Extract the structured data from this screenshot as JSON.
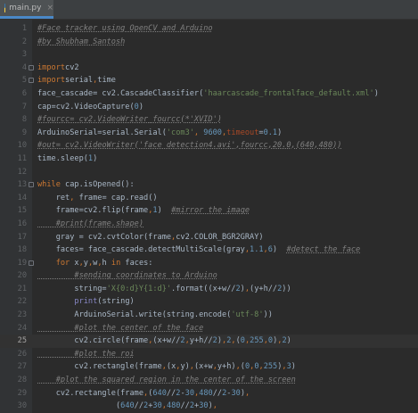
{
  "tab": {
    "label": "main.py",
    "close": "×",
    "icon": "python-file-icon"
  },
  "current_line": 25,
  "lines": [
    {
      "n": "1",
      "tokens": [
        [
          "cm",
          "#Face tracker using OpenCV and Arduino"
        ]
      ]
    },
    {
      "n": "2",
      "tokens": [
        [
          "cm",
          "#by Shubham Santosh"
        ]
      ]
    },
    {
      "n": "3",
      "tokens": []
    },
    {
      "n": "4",
      "tokens": [
        [
          "kw",
          "import"
        ],
        [
          "",
          "cv2"
        ]
      ]
    },
    {
      "n": "5",
      "tokens": [
        [
          "kw",
          "import"
        ],
        [
          "",
          "serial"
        ],
        [
          "op",
          ","
        ],
        [
          "",
          "time"
        ]
      ]
    },
    {
      "n": "6",
      "tokens": [
        [
          "",
          "face_cascade= cv2.CascadeClassifier("
        ],
        [
          "str",
          "'haarcascade_frontalface_default.xml'"
        ],
        [
          "",
          ")"
        ]
      ]
    },
    {
      "n": "7",
      "tokens": [
        [
          "",
          "cap=cv2.VideoCapture("
        ],
        [
          "num",
          "0"
        ],
        [
          "",
          ")"
        ]
      ]
    },
    {
      "n": "8",
      "tokens": [
        [
          "cm",
          "#fourcc= cv2.VideoWriter_fourcc(*'XVID')"
        ]
      ]
    },
    {
      "n": "9",
      "tokens": [
        [
          "",
          "ArduinoSerial=serial.Serial("
        ],
        [
          "str",
          "'com3'"
        ],
        [
          "op",
          ","
        ],
        [
          "num",
          " 9600"
        ],
        [
          "op",
          ","
        ],
        [
          "kwarg",
          "timeout"
        ],
        [
          "",
          "="
        ],
        [
          "num",
          "0.1"
        ],
        [
          "",
          ")"
        ]
      ]
    },
    {
      "n": "10",
      "tokens": [
        [
          "cm",
          "#out= cv2.VideoWriter('face detection4.avi',fourcc,20.0,(640,480))"
        ]
      ]
    },
    {
      "n": "11",
      "tokens": [
        [
          "",
          "time.sleep("
        ],
        [
          "num",
          "1"
        ],
        [
          "",
          ")"
        ]
      ]
    },
    {
      "n": "12",
      "tokens": []
    },
    {
      "n": "13",
      "tokens": [
        [
          "kw",
          "while"
        ],
        [
          "",
          " cap.isOpened():"
        ]
      ]
    },
    {
      "n": "14",
      "tokens": [
        [
          "",
          "    ret"
        ],
        [
          "op",
          ","
        ],
        [
          "",
          " frame= cap.read()"
        ]
      ]
    },
    {
      "n": "15",
      "tokens": [
        [
          "",
          "    frame=cv2.flip(frame"
        ],
        [
          "op",
          ","
        ],
        [
          "num",
          "1"
        ],
        [
          "",
          ")  "
        ],
        [
          "cm",
          "#mirror the image"
        ]
      ]
    },
    {
      "n": "16",
      "tokens": [
        [
          "cm",
          "    #print(frame.shape)"
        ]
      ]
    },
    {
      "n": "17",
      "tokens": [
        [
          "",
          "    gray = cv2.cvtColor(frame"
        ],
        [
          "op",
          ","
        ],
        [
          "",
          "cv2.COLOR_BGR2GRAY)"
        ]
      ]
    },
    {
      "n": "18",
      "tokens": [
        [
          "",
          "    faces= face_cascade.detectMultiScale(gray"
        ],
        [
          "op",
          ","
        ],
        [
          "num",
          "1.1"
        ],
        [
          "op",
          ","
        ],
        [
          "num",
          "6"
        ],
        [
          "",
          ")  "
        ],
        [
          "cm",
          "#detect the face"
        ]
      ]
    },
    {
      "n": "19",
      "tokens": [
        [
          "",
          "    "
        ],
        [
          "kw",
          "for"
        ],
        [
          "",
          " x"
        ],
        [
          "op",
          ","
        ],
        [
          "",
          "y"
        ],
        [
          "op",
          ","
        ],
        [
          "",
          "w"
        ],
        [
          "op",
          ","
        ],
        [
          "",
          "h "
        ],
        [
          "kw",
          "in"
        ],
        [
          "",
          " faces:"
        ]
      ]
    },
    {
      "n": "20",
      "tokens": [
        [
          "cm",
          "        #sending coordinates to Arduino"
        ]
      ]
    },
    {
      "n": "21",
      "tokens": [
        [
          "",
          "        string="
        ],
        [
          "str",
          "'X{0:d}Y{1:d}'"
        ],
        [
          "",
          ".format((x+w//"
        ],
        [
          "num",
          "2"
        ],
        [
          "",
          ")"
        ],
        [
          "op",
          ","
        ],
        [
          "",
          "(y+h//"
        ],
        [
          "num",
          "2"
        ],
        [
          "",
          "))"
        ]
      ]
    },
    {
      "n": "22",
      "tokens": [
        [
          "",
          "        "
        ],
        [
          "fn",
          "print"
        ],
        [
          "",
          "(string)"
        ]
      ]
    },
    {
      "n": "23",
      "tokens": [
        [
          "",
          "        ArduinoSerial.write(string.encode("
        ],
        [
          "str",
          "'utf-8'"
        ],
        [
          "",
          "))"
        ]
      ]
    },
    {
      "n": "24",
      "tokens": [
        [
          "cm",
          "        #plot the center of the face"
        ]
      ]
    },
    {
      "n": "25",
      "tokens": [
        [
          "",
          "        cv2.circle(frame"
        ],
        [
          "op",
          ","
        ],
        [
          "",
          "(x+w//"
        ],
        [
          "num",
          "2"
        ],
        [
          "op",
          ","
        ],
        [
          "",
          "y+h//"
        ],
        [
          "num",
          "2"
        ],
        [
          "",
          ")"
        ],
        [
          "op",
          ","
        ],
        [
          "num",
          "2"
        ],
        [
          "op",
          ","
        ],
        [
          "",
          "("
        ],
        [
          "num",
          "0"
        ],
        [
          "op",
          ","
        ],
        [
          "num",
          "255"
        ],
        [
          "op",
          ","
        ],
        [
          "num",
          "0"
        ],
        [
          "",
          ")"
        ],
        [
          "op",
          ","
        ],
        [
          "num",
          "2"
        ],
        [
          "",
          ")"
        ]
      ]
    },
    {
      "n": "26",
      "tokens": [
        [
          "cm",
          "        #plot the roi"
        ]
      ]
    },
    {
      "n": "27",
      "tokens": [
        [
          "",
          "        cv2.rectangle(frame"
        ],
        [
          "op",
          ","
        ],
        [
          "",
          "(x"
        ],
        [
          "op",
          ","
        ],
        [
          "",
          "y)"
        ],
        [
          "op",
          ","
        ],
        [
          "",
          "(x+w"
        ],
        [
          "op",
          ","
        ],
        [
          "",
          "y+h)"
        ],
        [
          "op",
          ","
        ],
        [
          "",
          "("
        ],
        [
          "num",
          "0"
        ],
        [
          "op",
          ","
        ],
        [
          "num",
          "0"
        ],
        [
          "op",
          ","
        ],
        [
          "num",
          "255"
        ],
        [
          "",
          ")"
        ],
        [
          "op",
          ","
        ],
        [
          "num",
          "3"
        ],
        [
          "",
          ")"
        ]
      ]
    },
    {
      "n": "28",
      "tokens": [
        [
          "cm",
          "    #plot the squared region in the center of the screen"
        ]
      ]
    },
    {
      "n": "29",
      "tokens": [
        [
          "",
          "    cv2.rectangle(frame"
        ],
        [
          "op",
          ","
        ],
        [
          "",
          "("
        ],
        [
          "num",
          "640"
        ],
        [
          "",
          "//"
        ],
        [
          "num",
          "2"
        ],
        [
          "",
          "-"
        ],
        [
          "num",
          "30"
        ],
        [
          "op",
          ","
        ],
        [
          "num",
          "480"
        ],
        [
          "",
          "//"
        ],
        [
          "num",
          "2"
        ],
        [
          "",
          "-"
        ],
        [
          "num",
          "30"
        ],
        [
          "",
          ")"
        ],
        [
          "op",
          ","
        ]
      ]
    },
    {
      "n": "30",
      "tokens": [
        [
          "",
          "                 ("
        ],
        [
          "num",
          "640"
        ],
        [
          "",
          "//"
        ],
        [
          "num",
          "2"
        ],
        [
          "",
          "+"
        ],
        [
          "num",
          "30"
        ],
        [
          "op",
          ","
        ],
        [
          "num",
          "480"
        ],
        [
          "",
          "//"
        ],
        [
          "num",
          "2"
        ],
        [
          "",
          "+"
        ],
        [
          "num",
          "30"
        ],
        [
          "",
          ")"
        ],
        [
          "op",
          ","
        ]
      ]
    }
  ],
  "fold_markers": [
    "4",
    "5",
    "13",
    "19"
  ]
}
